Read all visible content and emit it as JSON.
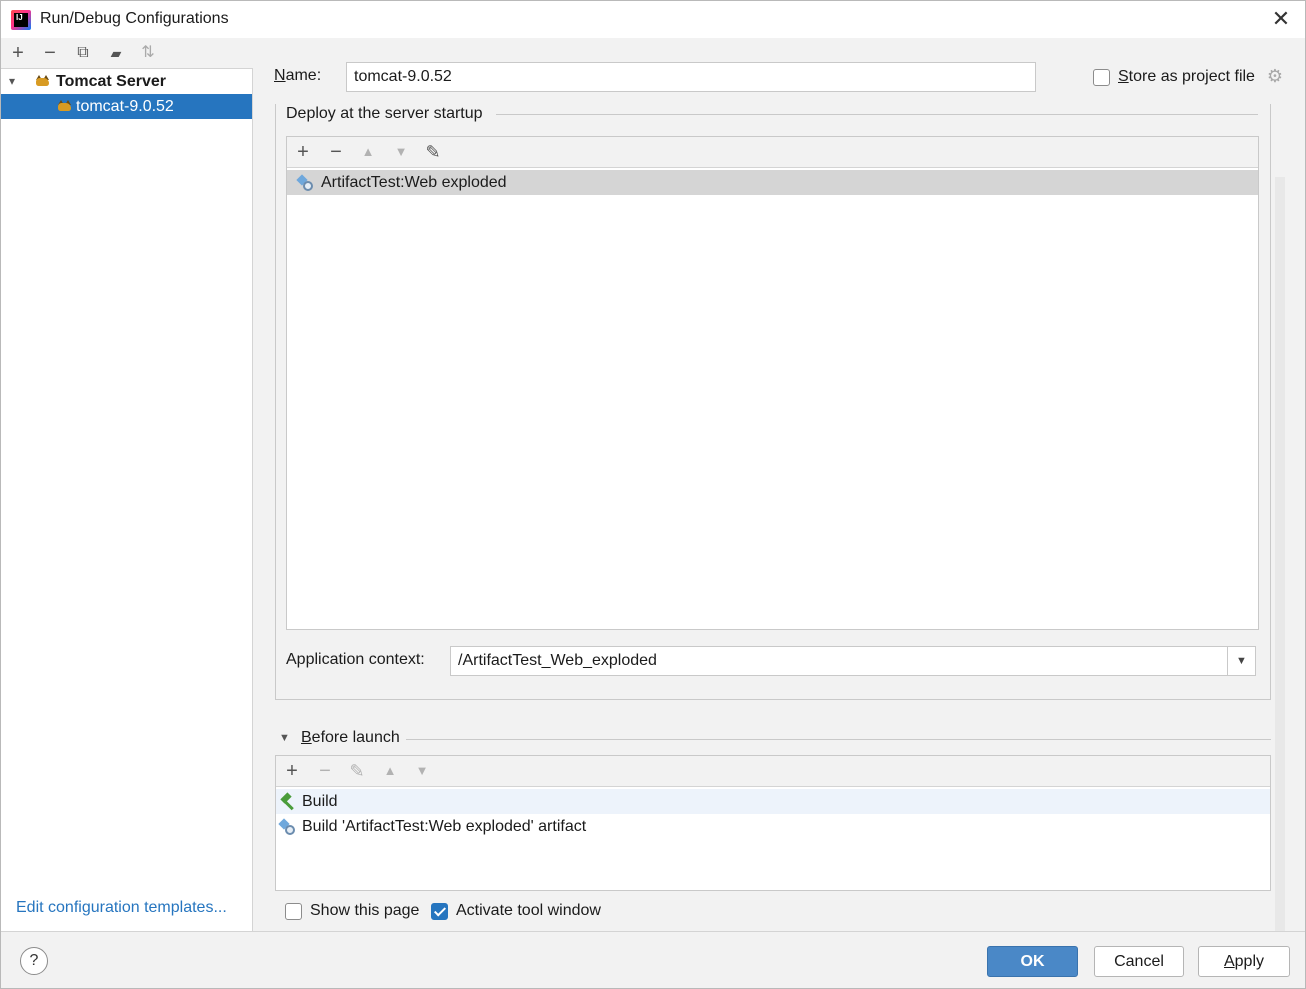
{
  "window": {
    "title": "Run/Debug Configurations",
    "app_icon_text": "IJ"
  },
  "left": {
    "toolbar": {
      "add": "+",
      "remove": "−",
      "copy": "⧉",
      "folder": "▰",
      "sort": "⇅"
    },
    "tree": {
      "group_label": "Tomcat Server",
      "item_label": "tomcat-9.0.52"
    },
    "edit_templates": "Edit configuration templates..."
  },
  "form": {
    "name_label": "Name:",
    "name_value": "tomcat-9.0.52",
    "store_label": "Store as project file",
    "store_checked": false
  },
  "deploy": {
    "legend": "Deploy at the server startup",
    "toolbar": {
      "add": "+",
      "remove": "−",
      "up": "▲",
      "down": "▼",
      "edit": "✎"
    },
    "items": [
      "ArtifactTest:Web exploded"
    ],
    "context_label": "Application context:",
    "context_value": "/ArtifactTest_Web_exploded"
  },
  "before_launch": {
    "label": "Before launch",
    "toolbar": {
      "add": "+",
      "remove": "−",
      "edit": "✎",
      "up": "▲",
      "down": "▼"
    },
    "items": [
      "Build",
      "Build 'ArtifactTest:Web exploded' artifact"
    ]
  },
  "options": {
    "show_page_label": "Show this page",
    "show_page_checked": false,
    "activate_label": "Activate tool window",
    "activate_checked": true
  },
  "buttons": {
    "help": "?",
    "ok": "OK",
    "cancel": "Cancel",
    "apply": "Apply"
  },
  "colors": {
    "accent": "#2675bf",
    "ok_button": "#4a88c7",
    "link": "#2675bf"
  }
}
